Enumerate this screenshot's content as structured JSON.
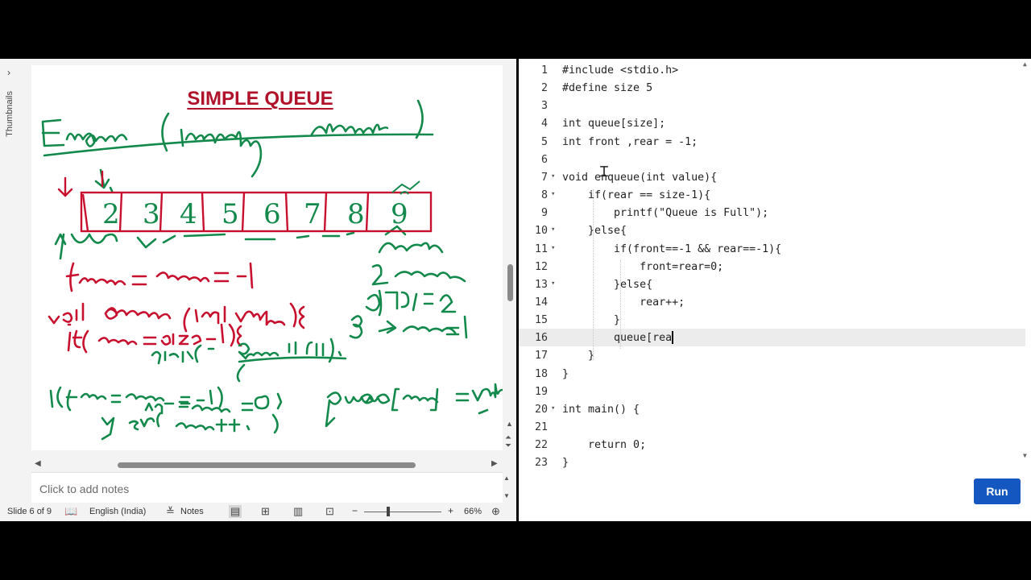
{
  "ppt": {
    "thumbnails_label": "Thumbnails",
    "thumbnails_arrow": "›",
    "slide": {
      "title": "SIMPLE QUEUE",
      "array_cells": [
        "2",
        "3",
        "4",
        "5",
        "6",
        "7",
        "8",
        "9"
      ]
    },
    "notes_placeholder": "Click to add notes",
    "status": {
      "slide_counter": "Slide 6 of 9",
      "language": "English (India)",
      "notes_label": "Notes",
      "zoom": "66%"
    }
  },
  "editor": {
    "lines": [
      {
        "n": "1",
        "fold": "",
        "text": "#include <stdio.h>"
      },
      {
        "n": "2",
        "fold": "",
        "text": "#define size 5"
      },
      {
        "n": "3",
        "fold": "",
        "text": ""
      },
      {
        "n": "4",
        "fold": "",
        "text": "int queue[size];"
      },
      {
        "n": "5",
        "fold": "",
        "text": "int front ,rear = -1;"
      },
      {
        "n": "6",
        "fold": "",
        "text": ""
      },
      {
        "n": "7",
        "fold": "▾",
        "text": "void enqueue(int value){"
      },
      {
        "n": "8",
        "fold": "▾",
        "text": "    if(rear == size-1){"
      },
      {
        "n": "9",
        "fold": "",
        "text": "        printf(\"Queue is Full\");"
      },
      {
        "n": "10",
        "fold": "▾",
        "text": "    }else{"
      },
      {
        "n": "11",
        "fold": "▾",
        "text": "        if(front==-1 && rear==-1){"
      },
      {
        "n": "12",
        "fold": "",
        "text": "            front=rear=0;"
      },
      {
        "n": "13",
        "fold": "▾",
        "text": "        }else{"
      },
      {
        "n": "14",
        "fold": "",
        "text": "            rear++;"
      },
      {
        "n": "15",
        "fold": "",
        "text": "        }"
      },
      {
        "n": "16",
        "fold": "",
        "text": "        queue[rea"
      },
      {
        "n": "17",
        "fold": "",
        "text": "    }"
      },
      {
        "n": "18",
        "fold": "",
        "text": "}"
      },
      {
        "n": "19",
        "fold": "",
        "text": ""
      },
      {
        "n": "20",
        "fold": "▾",
        "text": "int main() {"
      },
      {
        "n": "21",
        "fold": "",
        "text": ""
      },
      {
        "n": "22",
        "fold": "",
        "text": "    return 0;"
      },
      {
        "n": "23",
        "fold": "",
        "text": "}"
      }
    ],
    "active_line": 16,
    "run_label": "Run"
  },
  "colors": {
    "title_red": "#b0122a",
    "ink_green": "#13894b",
    "ink_red": "#c8102e",
    "run_blue": "#1557c0"
  }
}
